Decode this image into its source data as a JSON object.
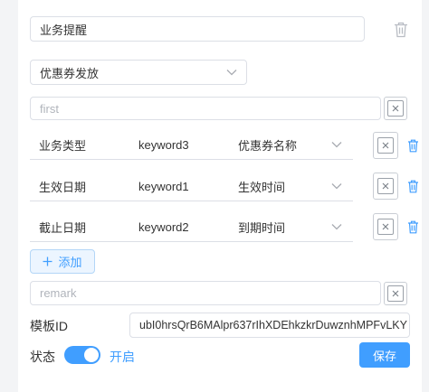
{
  "name_field": {
    "value": "业务提醒"
  },
  "type_select": {
    "value": "优惠券发放"
  },
  "first_field": {
    "placeholder": "first"
  },
  "mappings": [
    {
      "label": "业务类型",
      "keyword": "keyword3",
      "field": "优惠券名称"
    },
    {
      "label": "生效日期",
      "keyword": "keyword1",
      "field": "生效时间"
    },
    {
      "label": "截止日期",
      "keyword": "keyword2",
      "field": "到期时间"
    }
  ],
  "add_button": {
    "label": "添加",
    "icon": "plus-icon"
  },
  "remark_field": {
    "placeholder": "remark"
  },
  "template": {
    "label": "模板ID",
    "value": "ubI0hrsQrB6MAlpr637rIhXDEhkzkrDuwznhMPFvLKY"
  },
  "status": {
    "label": "状态",
    "on_text": "开启",
    "enabled": true
  },
  "save_button": {
    "label": "保存"
  },
  "colors": {
    "accent": "#409eff",
    "border": "#dcdfe6",
    "text": "#333333",
    "placeholder": "#b0b4bb"
  }
}
